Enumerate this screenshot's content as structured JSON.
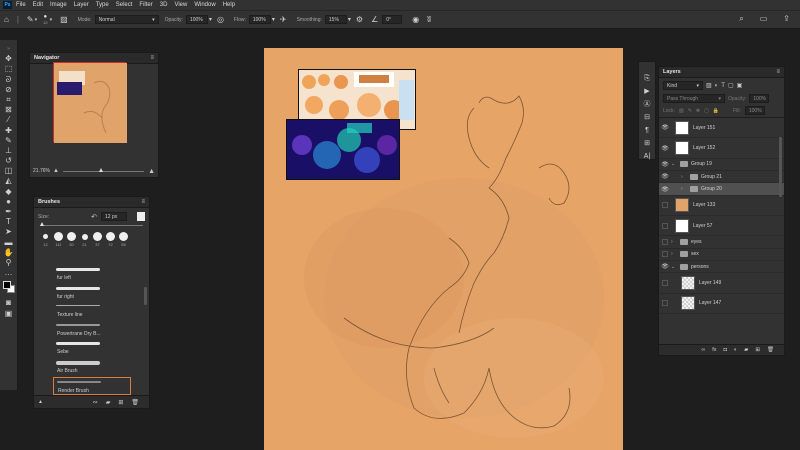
{
  "menubar": {
    "logo": "Ps",
    "items": [
      "File",
      "Edit",
      "Image",
      "Layer",
      "Type",
      "Select",
      "Filter",
      "3D",
      "View",
      "Window",
      "Help"
    ]
  },
  "options_bar": {
    "brush_size": "12",
    "mode_label": "Mode:",
    "mode_value": "Normal",
    "opacity_label": "Opacity:",
    "opacity_value": "100%",
    "flow_label": "Flow:",
    "flow_value": "100%",
    "smoothing_label": "Smoothing:",
    "smoothing_value": "15%",
    "angle_value": "0°"
  },
  "navigator": {
    "title": "Navigator",
    "zoom": "21.76%"
  },
  "brushes": {
    "title": "Brushes",
    "size_label": "Size:",
    "size_value": "12 px",
    "tip_sizes": [
      "12",
      "111",
      "30",
      "21",
      "37",
      "72",
      "55"
    ],
    "items": [
      {
        "name": "fur left"
      },
      {
        "name": "fur right"
      },
      {
        "name": "Texture line"
      },
      {
        "name": "Powertrane Dry B..."
      },
      {
        "name": "Sebe"
      },
      {
        "name": "Air Brush"
      },
      {
        "name": "Render Brush"
      }
    ]
  },
  "layers": {
    "title": "Layers",
    "kind_label": "Kind",
    "blend_mode": "Pass Through",
    "opacity_label": "Opacity:",
    "opacity_value": "100%",
    "lock_label": "Lock:",
    "fill_label": "Fill:",
    "fill_value": "100%",
    "rows": [
      {
        "name": "Layer 151",
        "visible": true
      },
      {
        "name": "Layer 152",
        "visible": true
      },
      {
        "name": "Group 19",
        "visible": true
      },
      {
        "name": "Group 21",
        "visible": true
      },
      {
        "name": "Group 20",
        "visible": true
      },
      {
        "name": "Layer 133",
        "visible": false
      },
      {
        "name": "Layer 57",
        "visible": false
      },
      {
        "name": "eyes",
        "visible": false
      },
      {
        "name": "sex",
        "visible": false
      },
      {
        "name": "persons",
        "visible": true
      },
      {
        "name": "Layer 149",
        "visible": false
      },
      {
        "name": "Layer 147",
        "visible": false
      }
    ]
  }
}
